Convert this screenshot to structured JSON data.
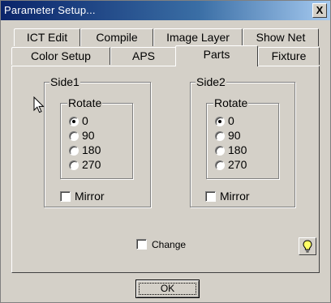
{
  "window": {
    "title": "Parameter Setup...",
    "close_label": "X"
  },
  "tabs": {
    "row_top": [
      {
        "label": "ICT Edit"
      },
      {
        "label": "Compile"
      },
      {
        "label": "Image Layer"
      },
      {
        "label": "Show Net"
      }
    ],
    "row_bottom": [
      {
        "label": "Color Setup"
      },
      {
        "label": "APS"
      },
      {
        "label": "Parts"
      },
      {
        "label": "Fixture"
      }
    ],
    "selected": "Parts"
  },
  "side1": {
    "title": "Side1",
    "rotate": {
      "title": "Rotate",
      "options": [
        "0",
        "90",
        "180",
        "270"
      ],
      "selected": "0"
    },
    "mirror_label": "Mirror",
    "mirror_checked": false
  },
  "side2": {
    "title": "Side2",
    "rotate": {
      "title": "Rotate",
      "options": [
        "0",
        "90",
        "180",
        "270"
      ],
      "selected": "0"
    },
    "mirror_label": "Mirror",
    "mirror_checked": false
  },
  "change": {
    "label": "Change",
    "checked": false
  },
  "icons": {
    "bulb": "lightbulb-icon",
    "cursor": "mouse-pointer-icon"
  },
  "footer": {
    "ok_label": "OK"
  },
  "colors": {
    "face": "#d4d0c8",
    "title_start": "#0a246a",
    "title_end": "#a6caf0",
    "bulb": "#ffff66"
  }
}
